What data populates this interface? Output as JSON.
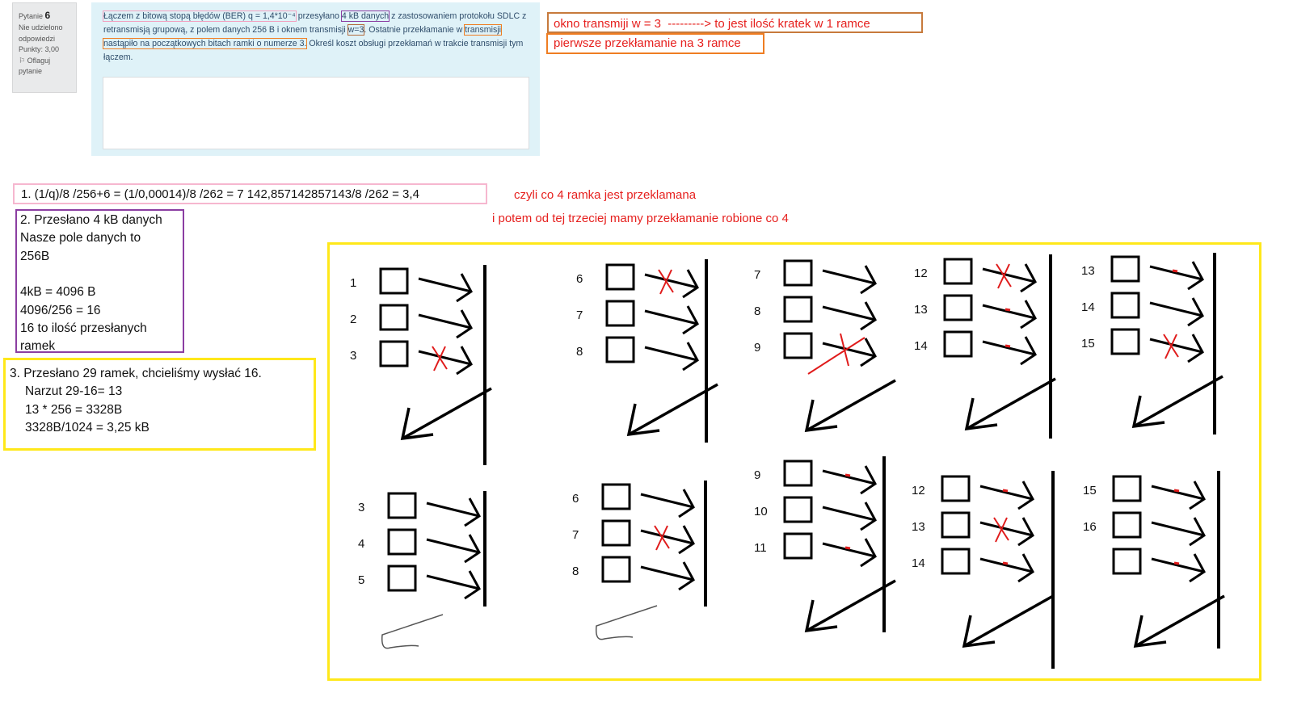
{
  "question_info": {
    "label": "Pytanie",
    "number": "6",
    "status": "Nie udzielono odpowiedzi",
    "points": "Punkty: 3,00",
    "flag": "Oflaguj pytanie"
  },
  "question": {
    "seg1": "Łączem z bitową stopą błędów (BER) q = 1,4*10⁻⁴",
    "seg2": " przesyłano ",
    "seg3": "4 kB danych",
    "seg4": " z zastosowaniem protokołu SDLC z retransmisją grupową, z polem danych 256 B i oknem transmisji ",
    "seg5": "w=3",
    "seg6": ". Ostatnie przekłamanie w ",
    "seg7": "transmisji nastąpiło na początkowych bitach ramki o numerze 3.",
    "seg8": " Określ koszt obsługi przekłamań w trakcie transmisji tym łączem."
  },
  "notes": {
    "n1": "okno transmiji w = 3  ---------> to jest ilość kratek w 1 ramce",
    "n2": "pierwsze przekłamanie na 3 ramce",
    "n3": "czyli co 4 ramka jest przeklamana",
    "n4": "i potem od tej trzeciej mamy przekłamanie robione co 4"
  },
  "step1": "1.  (1/q)/8 /256+6 = (1/0,00014)/8  /262 = 7 142,857142857143/8 /262 = 3,4",
  "step2": [
    "2. Przesłano 4 kB danych",
    "Nasze pole danych to",
    "256B",
    "",
    "4kB = 4096 B",
    "4096/256 = 16",
    "16 to ilość przesłanych",
    "ramek"
  ],
  "step3": [
    "3. Przesłano 29 ramek, chcieliśmy wysłać 16.",
    "Narzut 29-16= 13",
    "13 * 256 = 3328B",
    "3328B/1024 = 3,25 kB"
  ],
  "diagram": {
    "groups": [
      {
        "frames": [
          "1",
          "2",
          "3"
        ]
      },
      {
        "frames": [
          "6",
          "7",
          "8"
        ]
      },
      {
        "frames": [
          "7",
          "8",
          "9"
        ]
      },
      {
        "frames": [
          "12",
          "13",
          "14"
        ]
      },
      {
        "frames": [
          "13",
          "14",
          "15"
        ]
      },
      {
        "frames": [
          "3",
          "4",
          "5"
        ]
      },
      {
        "frames": [
          "6",
          "7",
          "8"
        ]
      },
      {
        "frames": [
          "9",
          "10",
          "11"
        ]
      },
      {
        "frames": [
          "12",
          "13",
          "14"
        ]
      },
      {
        "frames": [
          "15",
          "16",
          ""
        ]
      }
    ]
  }
}
